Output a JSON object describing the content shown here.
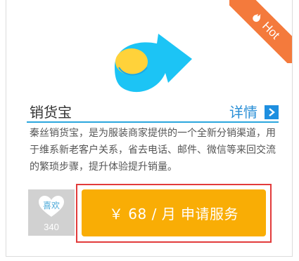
{
  "badge": {
    "label": "Hot"
  },
  "app": {
    "name": "销货宝",
    "details_label": "详情",
    "description": "秦丝销货宝，是为服装商家提供的一个全新分销渠道，用于维系新老客户关系，省去电话、邮件、微信等来回交流的繁琐步骤，提升体验提升销量。"
  },
  "like": {
    "label": "喜欢",
    "count": "340"
  },
  "cta": {
    "label": "￥ 68 / 月  申请服务"
  },
  "colors": {
    "ribbon": "#f47a3c",
    "accent_blue": "#2a8fd6",
    "button_orange": "#f9ad05",
    "highlight_red": "#e23b3b",
    "like_bg": "#d1d1d1"
  },
  "icons": {
    "badge_icon": "fire-icon",
    "logo": "app-logo-icon",
    "details_arrow": "chevron-right-icon",
    "like_icon": "heart-icon"
  }
}
